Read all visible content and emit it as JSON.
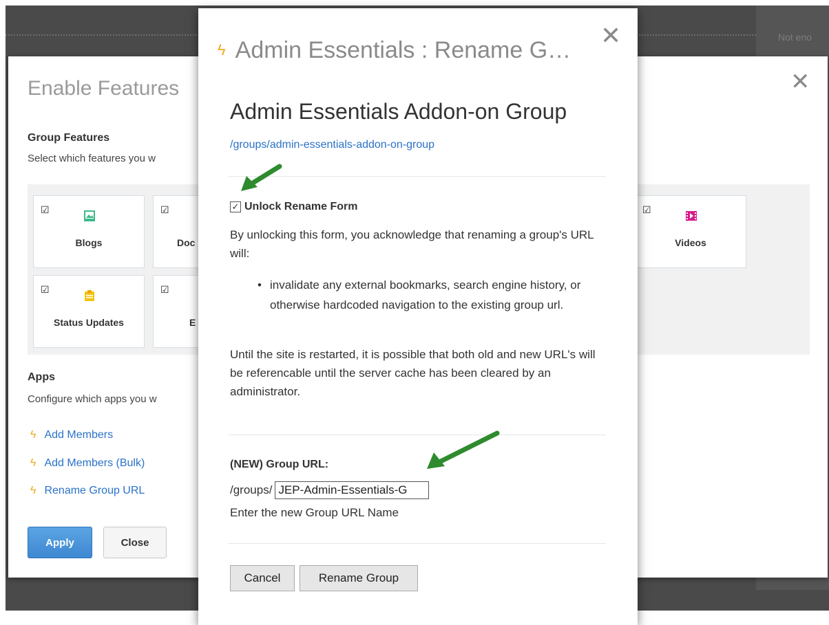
{
  "background": {
    "sidebar_text": "Not eno"
  },
  "features_dialog": {
    "title": "Enable Features",
    "group_features_heading": "Group Features",
    "group_features_desc": "Select which features you w",
    "features": [
      {
        "label": "Blogs",
        "checked": true,
        "icon": "image-icon",
        "color": "#3fb98a"
      },
      {
        "label": "Doc",
        "checked": true,
        "icon": "document-icon",
        "color": "#7a7a7a"
      },
      {
        "label": "Videos",
        "checked": true,
        "icon": "video-icon",
        "color": "#d81b8c"
      },
      {
        "label": "Status Updates",
        "checked": true,
        "icon": "status-icon",
        "color": "#f3c418"
      },
      {
        "label": "E",
        "checked": true,
        "icon": "event-icon",
        "color": "#7a7a7a"
      }
    ],
    "apps_heading": "Apps",
    "apps_desc": "Configure which apps you w",
    "apps": [
      {
        "label": "Add Members"
      },
      {
        "label": "Add Members (Bulk)"
      },
      {
        "label": "Rename Group URL"
      }
    ],
    "apply_label": "Apply",
    "close_label": "Close"
  },
  "rename_modal": {
    "title": "Admin Essentials : Rename G…",
    "group_name": "Admin Essentials Addon-on Group",
    "group_path": "/groups/admin-essentials-addon-on-group",
    "unlock_label": "Unlock Rename Form",
    "unlock_checked": true,
    "intro_text": "By unlocking this form, you acknowledge that renaming a group's URL will:",
    "bullets": [
      "invalidate any external bookmarks, search engine history, or otherwise hardcoded navigation to the existing group url."
    ],
    "cache_text": "Until the site is restarted, it is possible that both old and new URL's will be referencable until the server cache has been cleared by an administrator.",
    "new_url_label": "(NEW) Group URL:",
    "url_prefix": "/groups/",
    "url_value": "JEP-Admin-Essentials-G",
    "url_help": "Enter the new Group URL Name",
    "cancel_label": "Cancel",
    "rename_label": "Rename Group"
  },
  "colors": {
    "link": "#2a72c7",
    "accent_arrow": "#2e8b2e",
    "apply_button": "#3e88d2",
    "bolt": "#f3a91f"
  }
}
